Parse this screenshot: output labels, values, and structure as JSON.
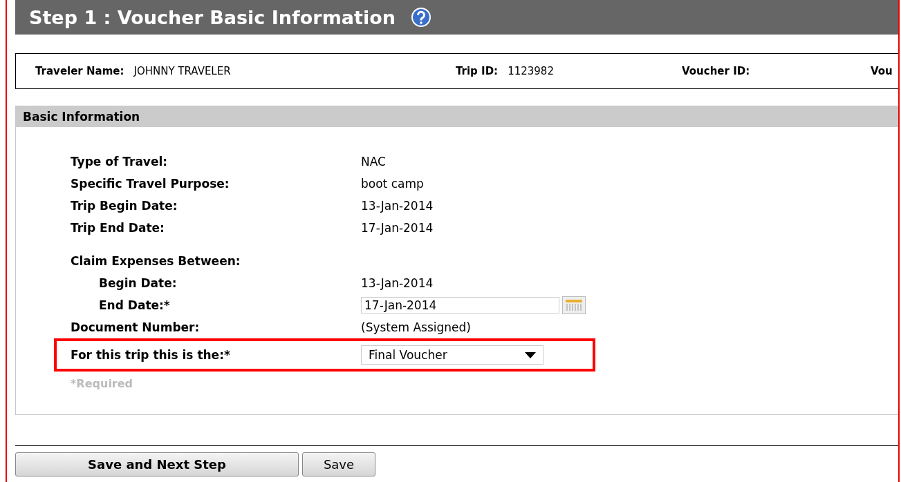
{
  "header": {
    "title": "Step 1 : Voucher Basic Information"
  },
  "info_bar": [
    {
      "label": "Traveler Name:",
      "value": "JOHNNY TRAVELER"
    },
    {
      "label": "Trip ID:",
      "value": "1123982"
    },
    {
      "label": "Voucher ID:"
    },
    {
      "label": "Vou"
    }
  ],
  "section": {
    "title": "Basic Information",
    "rows": [
      {
        "kind": "text",
        "label": "Type of Travel:",
        "value": "NAC"
      },
      {
        "kind": "text",
        "label": "Specific Travel Purpose:",
        "value": "boot camp"
      },
      {
        "kind": "text",
        "label": "Trip Begin Date:",
        "value": "13-Jan-2014"
      },
      {
        "kind": "text",
        "label": "Trip End Date:",
        "value": "17-Jan-2014"
      },
      {
        "kind": "group",
        "label": "Claim Expenses Between:",
        "children": [
          {
            "kind": "text",
            "label": "Begin Date:",
            "value": "13-Jan-2014"
          },
          {
            "kind": "date",
            "label": "End Date:*",
            "value": "17-Jan-2014"
          }
        ]
      },
      {
        "kind": "text",
        "label": "Document Number:",
        "value": "(System Assigned)"
      },
      {
        "kind": "select",
        "label": "For this trip this is the:*",
        "value": "Final Voucher",
        "highlighted": true
      }
    ],
    "note": "*Required"
  },
  "buttons": [
    {
      "label": "Save and Next Step",
      "primary": true
    },
    {
      "label": "Save",
      "primary": false
    }
  ]
}
